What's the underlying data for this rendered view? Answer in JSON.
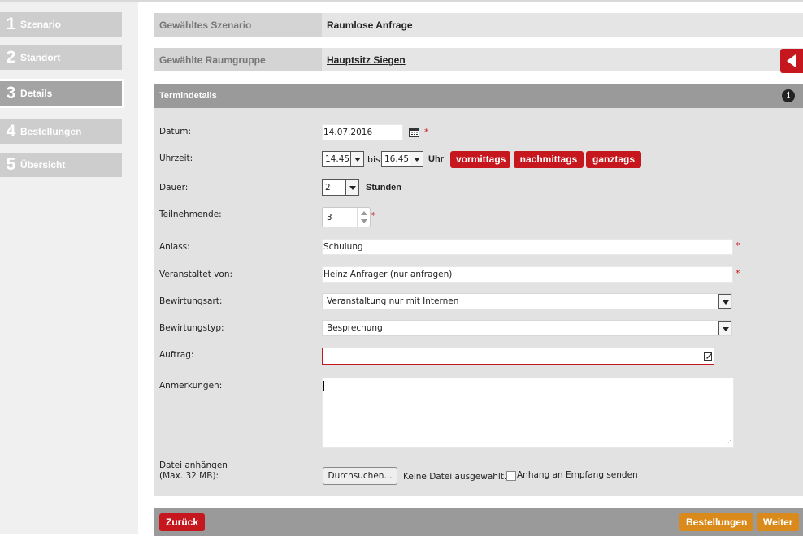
{
  "steps": [
    {
      "num": "1",
      "label": "Szenario"
    },
    {
      "num": "2",
      "label": "Standort"
    },
    {
      "num": "3",
      "label": "Details"
    },
    {
      "num": "4",
      "label": "Bestellungen"
    },
    {
      "num": "5",
      "label": "Übersicht"
    }
  ],
  "summary": {
    "scenario_label": "Gewähltes Szenario",
    "scenario_value": "Raumlose Anfrage",
    "group_label": "Gewählte Raumgruppe",
    "group_value": "Hauptsitz Siegen"
  },
  "panel": {
    "title": "Termindetails",
    "info_icon": "i"
  },
  "form": {
    "datum_label": "Datum:",
    "datum_value": "14.07.2016",
    "uhrzeit_label": "Uhrzeit:",
    "time_from": "14.45",
    "bis": "bis",
    "time_to": "16.45",
    "uhr": "Uhr",
    "presets": [
      "vormittags",
      "nachmittags",
      "ganztags"
    ],
    "dauer_label": "Dauer:",
    "dauer_value": "2",
    "stunden": "Stunden",
    "teilnehmende_label": "Teilnehmende:",
    "teilnehmende_value": "3",
    "anlass_label": "Anlass:",
    "anlass_value": "Schulung",
    "veranstaltet_label": "Veranstaltet von:",
    "veranstaltet_value": "Heinz Anfrager (nur anfragen)",
    "bewirtungsart_label": "Bewirtungsart:",
    "bewirtungsart_value": "Veranstaltung nur mit Internen",
    "bewirtungstyp_label": "Bewirtungstyp:",
    "bewirtungstyp_value": "Besprechung",
    "auftrag_label": "Auftrag:",
    "auftrag_value": "",
    "anmerkungen_label": "Anmerkungen:",
    "anmerkungen_value": "",
    "datei_label1": "Datei anhängen",
    "datei_label2": "(Max. 32 MB):",
    "browse": "Durchsuchen...",
    "no_file": "Keine Datei ausgewählt.",
    "send_attachment": "Anhang an Empfang senden",
    "required_mark": "*"
  },
  "footer": {
    "back": "Zurück",
    "orders": "Bestellungen",
    "next": "Weiter"
  },
  "colors": {
    "accent_red": "#c7171e",
    "accent_orange": "#d98a1a"
  }
}
